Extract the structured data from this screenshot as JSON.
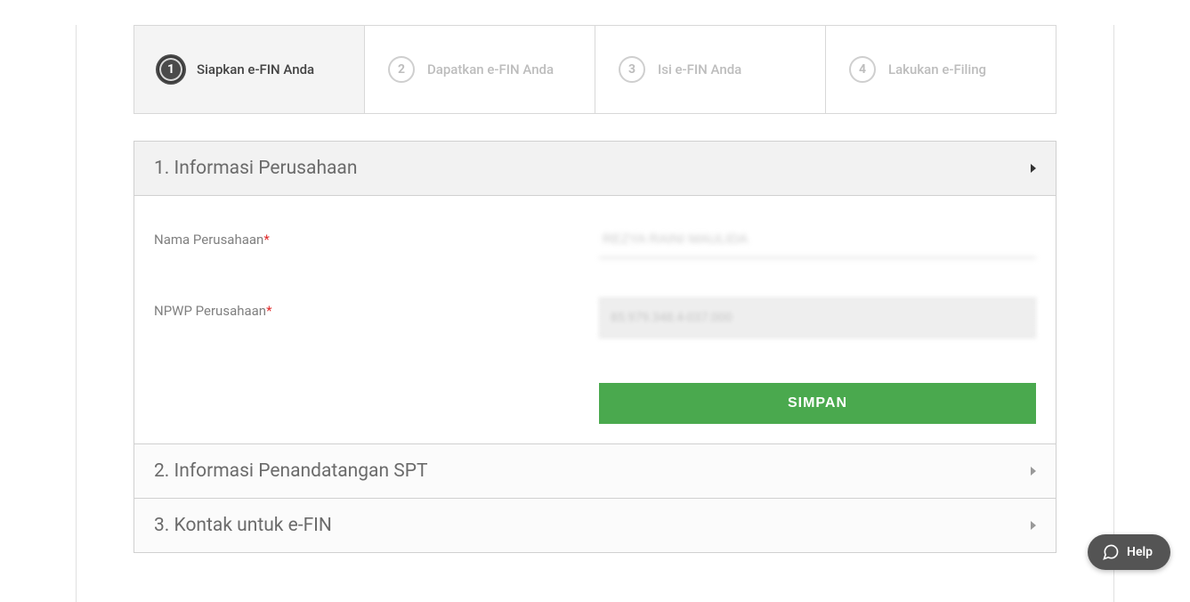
{
  "stepper": {
    "steps": [
      {
        "num": "1",
        "label": "Siapkan e-FIN Anda",
        "active": true
      },
      {
        "num": "2",
        "label": "Dapatkan e-FIN Anda",
        "active": false
      },
      {
        "num": "3",
        "label": "Isi e-FIN Anda",
        "active": false
      },
      {
        "num": "4",
        "label": "Lakukan e-Filing",
        "active": false
      }
    ]
  },
  "panels": {
    "p1": {
      "title": "1. Informasi Perusahaan",
      "fields": {
        "company_name_label": "Nama Perusahaan",
        "company_name_value": "REZYA RAINI MAULIDA",
        "npwp_label": "NPWP Perusahaan",
        "npwp_value": "85.979.348.4-037.000"
      },
      "save_label": "SIMPAN"
    },
    "p2": {
      "title": "2. Informasi Penandatangan SPT"
    },
    "p3": {
      "title": "3. Kontak untuk e-FIN"
    }
  },
  "help": {
    "label": "Help"
  }
}
